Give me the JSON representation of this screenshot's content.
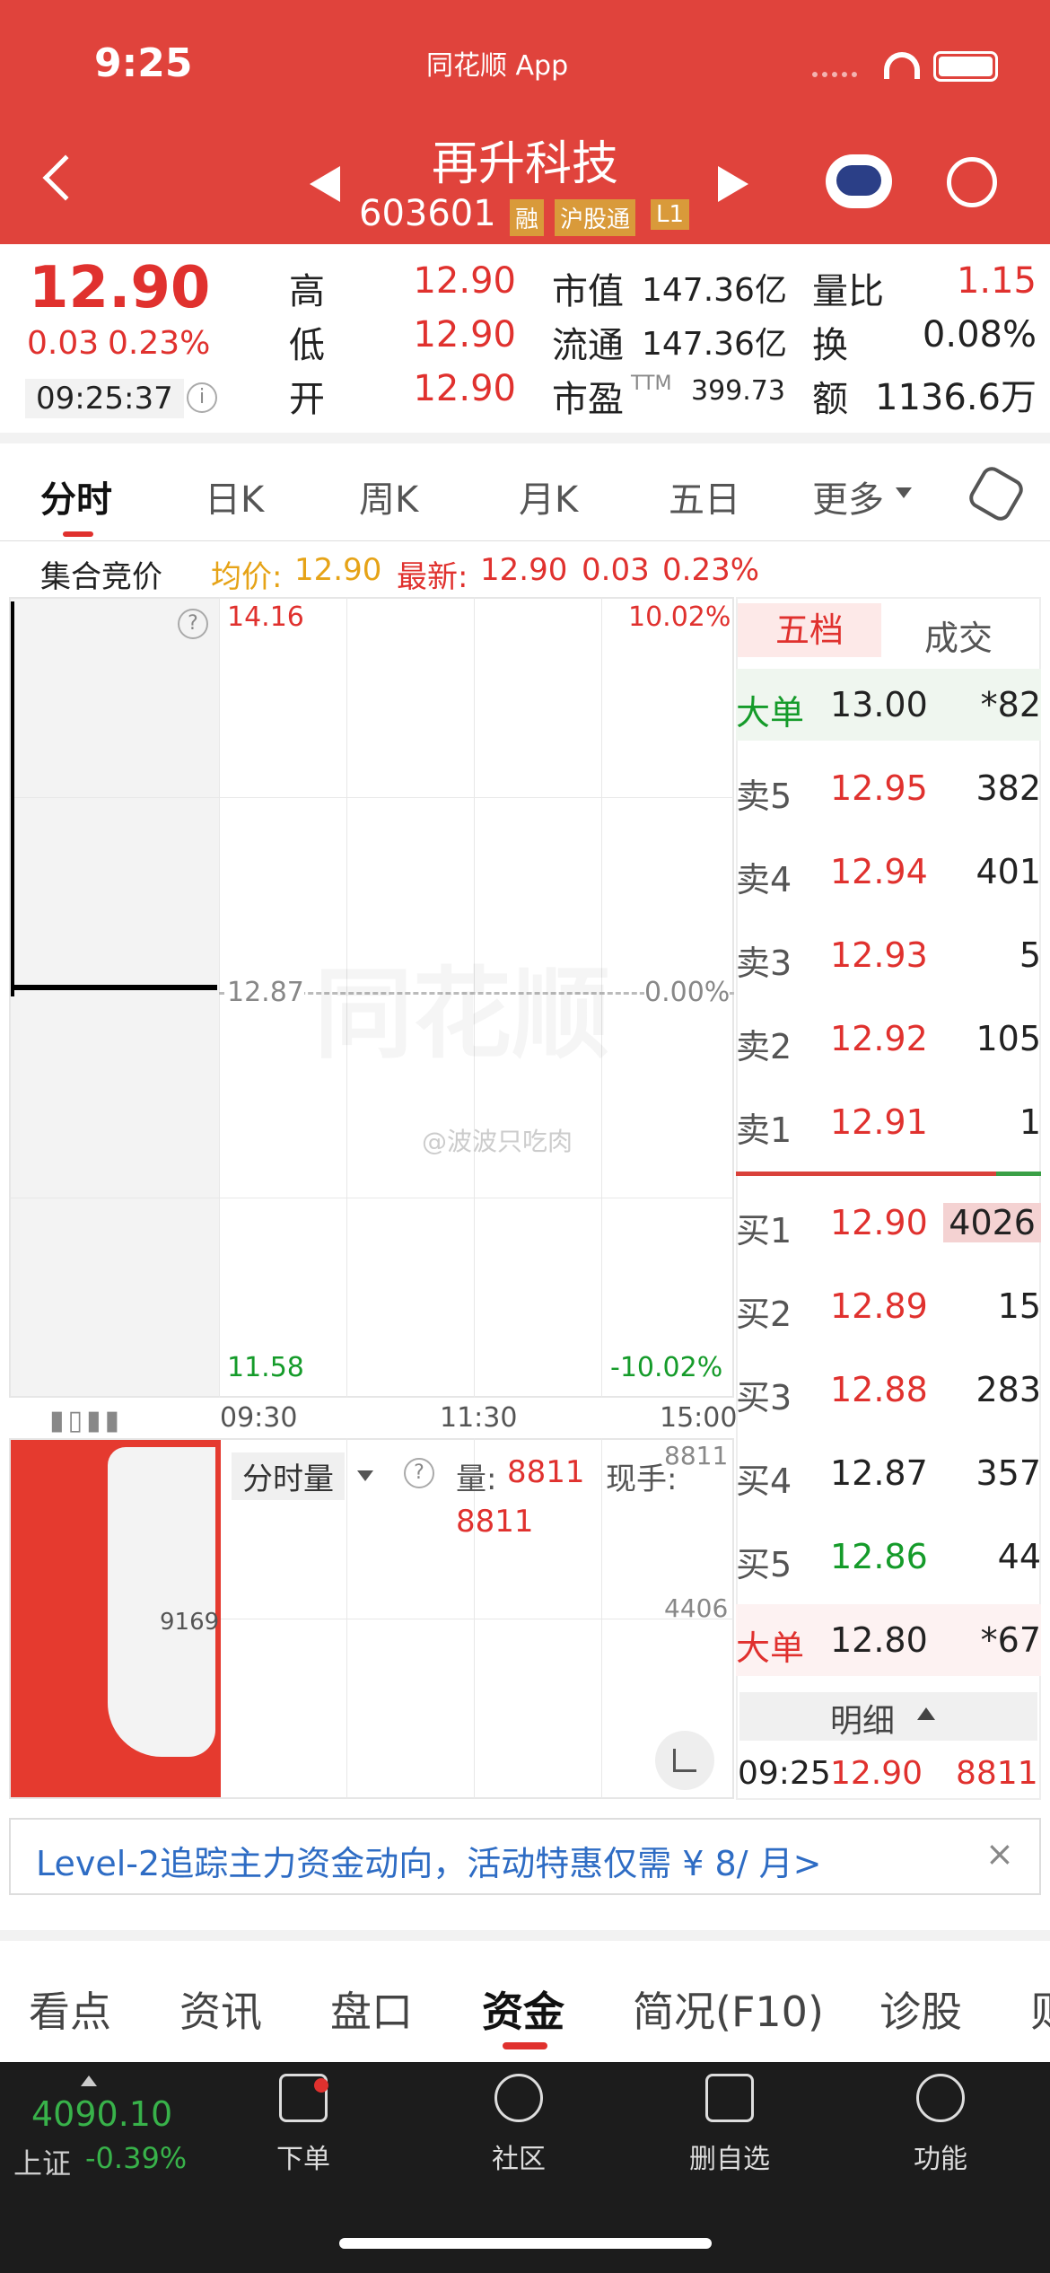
{
  "status_bar": {
    "time": "9:25",
    "app_label": "同花顺 App"
  },
  "header": {
    "title": "再升科技",
    "code": "603601",
    "badges": [
      "融",
      "沪股通",
      "L1"
    ]
  },
  "quote": {
    "price": "12.90",
    "change": "0.03",
    "change_pct": "0.23%",
    "time": "09:25:37",
    "stats": [
      {
        "label": "高",
        "value": "12.90"
      },
      {
        "label": "低",
        "value": "12.90"
      },
      {
        "label": "开",
        "value": "12.90"
      },
      {
        "label": "市值",
        "value": "147.36亿"
      },
      {
        "label": "流通",
        "value": "147.36亿"
      },
      {
        "label": "市盈",
        "sup": "TTM",
        "value": "399.73"
      },
      {
        "label": "量比",
        "value": "1.15"
      },
      {
        "label": "换",
        "value": "0.08%"
      },
      {
        "label": "额",
        "value": "1136.6万"
      }
    ]
  },
  "chart_tabs": [
    "分时",
    "日K",
    "周K",
    "月K",
    "五日",
    "更多"
  ],
  "info_line": {
    "auction": "集合竞价",
    "avg_label": "均价:",
    "avg": "12.90",
    "latest_label": "最新:",
    "latest": "12.90",
    "chg": "0.03",
    "pct": "0.23%"
  },
  "chart": {
    "high": "14.16",
    "high_pct": "10.02%",
    "mid": "12.87",
    "mid_pct": "0.00%",
    "low": "11.58",
    "low_pct": "-10.02%",
    "x_labels": [
      "09:30",
      "11:30",
      "15:00"
    ],
    "watermark": "同花顺",
    "weibo": "@波波只吃肉",
    "vol_label": "分时量",
    "vol_text": "量:",
    "vol_value": "8811",
    "vol_value2": "8811",
    "hand_label": "现手:",
    "vol_top": "8811",
    "vol_mid": "4406",
    "left_vol": "9169"
  },
  "chart_data": {
    "type": "line",
    "x": [
      "09:30",
      "11:30",
      "15:00"
    ],
    "y_range": [
      11.58,
      14.16
    ],
    "reference": 12.87,
    "values": [
      12.9
    ],
    "volume_range": [
      0,
      8811
    ]
  },
  "orderbook": {
    "tabs": [
      "五档",
      "成交"
    ],
    "big_sell": {
      "label": "大单",
      "price": "13.00",
      "vol": "*82"
    },
    "sells": [
      {
        "label": "卖5",
        "price": "12.95",
        "vol": "382"
      },
      {
        "label": "卖4",
        "price": "12.94",
        "vol": "401"
      },
      {
        "label": "卖3",
        "price": "12.93",
        "vol": "5"
      },
      {
        "label": "卖2",
        "price": "12.92",
        "vol": "105"
      },
      {
        "label": "卖1",
        "price": "12.91",
        "vol": "1"
      }
    ],
    "buys": [
      {
        "label": "买1",
        "price": "12.90",
        "vol": "4026"
      },
      {
        "label": "买2",
        "price": "12.89",
        "vol": "15"
      },
      {
        "label": "买3",
        "price": "12.88",
        "vol": "283"
      },
      {
        "label": "买4",
        "price": "12.87",
        "vol": "357"
      },
      {
        "label": "买5",
        "price": "12.86",
        "vol": "44"
      }
    ],
    "big_buy": {
      "label": "大单",
      "price": "12.80",
      "vol": "*67"
    },
    "detail_label": "明细",
    "last_trade": {
      "time": "09:25",
      "price": "12.90",
      "vol": "8811"
    }
  },
  "banner": "Level-2追踪主力资金动向，活动特惠仅需 ¥ 8/ 月>",
  "bottom_tabs": [
    "看点",
    "资讯",
    "盘口",
    "资金",
    "简况(F10)",
    "诊股",
    "则"
  ],
  "nav": {
    "index_value": "4090.10",
    "index_name": "上证",
    "index_pct": "-0.39%",
    "items": [
      "下单",
      "社区",
      "删自选",
      "功能"
    ]
  }
}
